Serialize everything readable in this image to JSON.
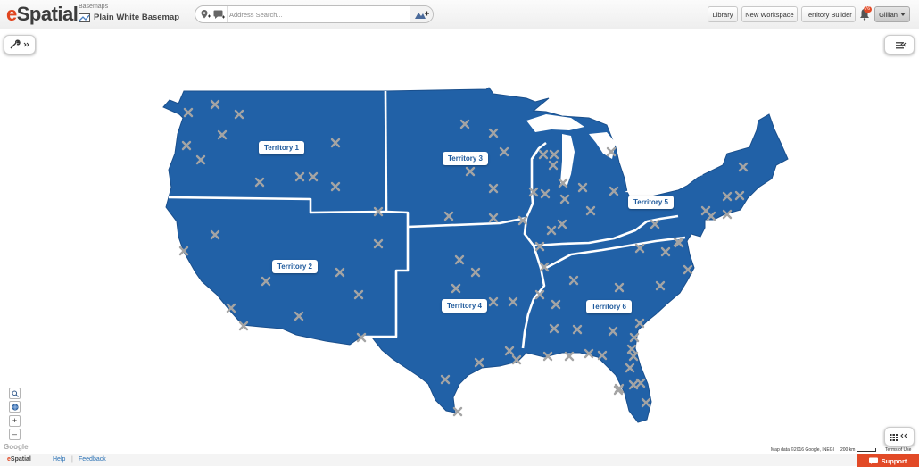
{
  "header": {
    "logo_prefix": "e",
    "logo_rest": "Spatial",
    "basemap_caption": "Basemaps",
    "basemap_title": "Plain White Basemap",
    "search_placeholder": "Address Search...",
    "buttons": {
      "library": "Library",
      "new_workspace": "New Workspace",
      "territory_builder": "Territory Builder"
    },
    "notification_count": "76",
    "user_name": "Gillian"
  },
  "map": {
    "fill_color": "#2161a7",
    "border_color": "#ffffff",
    "marker_color": "#a4a4a4",
    "territories": [
      {
        "label": "Territory 1"
      },
      {
        "label": "Territory 2"
      },
      {
        "label": "Territory 3"
      },
      {
        "label": "Territory 4"
      },
      {
        "label": "Territory 5"
      },
      {
        "label": "Territory 6"
      }
    ],
    "google_mark": "Google",
    "attribution": "Map data ©2016 Google, INEGI",
    "scale": "200 km",
    "terms": "Terms of Use"
  },
  "controls": {
    "tools_icon": "wrench-icon",
    "layers_icon": "list-icon",
    "grid_icon": "grid-icon",
    "zoom_in": "+",
    "zoom_out": "–"
  },
  "footer": {
    "logo_prefix": "e",
    "logo_rest": "Spatial",
    "help": "Help",
    "feedback": "Feedback",
    "support": "Support"
  }
}
